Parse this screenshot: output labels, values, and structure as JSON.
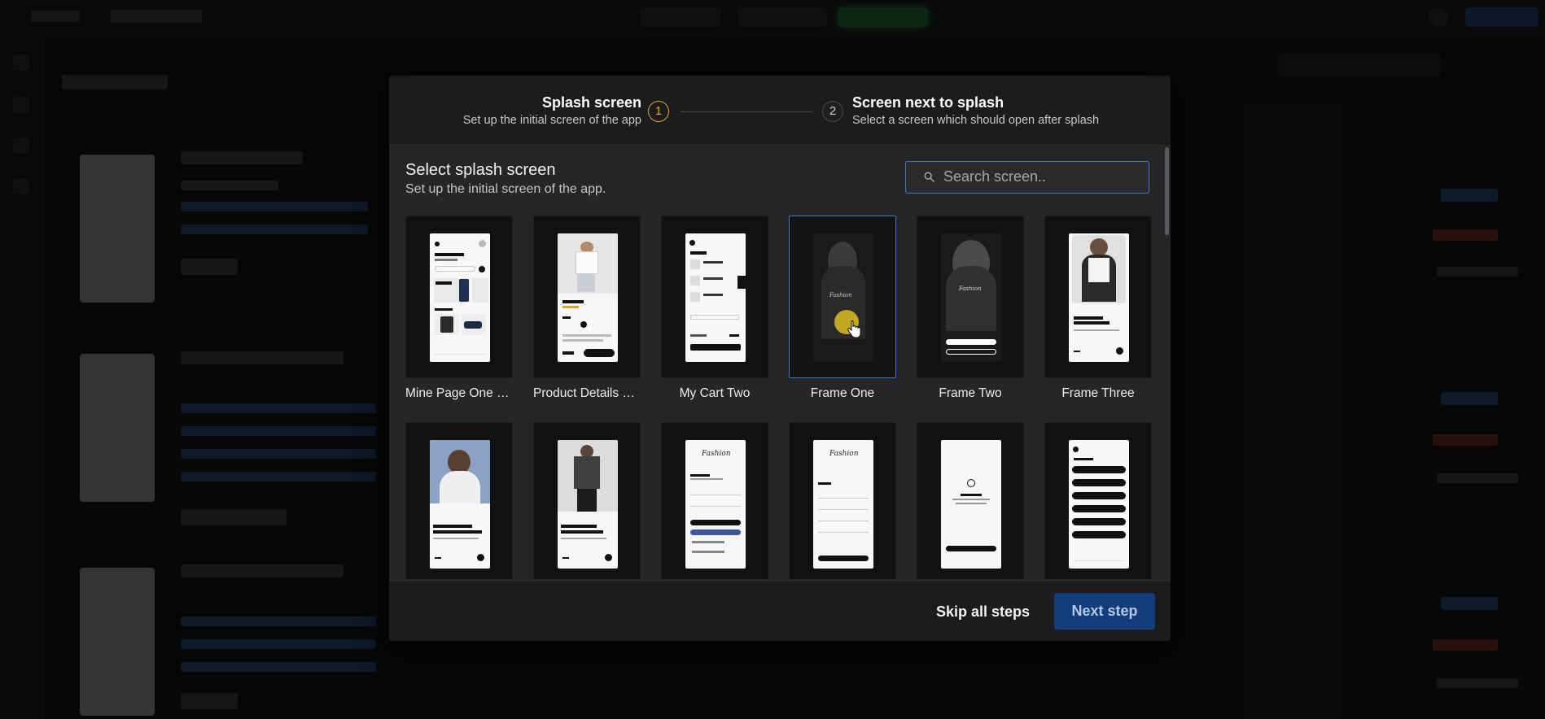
{
  "stepper": {
    "steps": [
      {
        "number": "1",
        "title": "Splash screen",
        "subtitle": "Set up the initial screen of the app",
        "state": "active"
      },
      {
        "number": "2",
        "title": "Screen next to splash",
        "subtitle": "Select a screen which should open after splash",
        "state": "pending"
      }
    ]
  },
  "section": {
    "title": "Select splash screen",
    "subtitle": "Set up the initial screen of the app."
  },
  "search": {
    "placeholder": "Search screen..",
    "value": ""
  },
  "screens": [
    {
      "label": "Mine Page One - Consistent",
      "selected": false
    },
    {
      "label": "Product Details One",
      "selected": false
    },
    {
      "label": "My Cart Two",
      "selected": false
    },
    {
      "label": "Frame One",
      "selected": true
    },
    {
      "label": "Frame Two",
      "selected": false
    },
    {
      "label": "Frame Three",
      "selected": false
    },
    {
      "label": "",
      "selected": false
    },
    {
      "label": "",
      "selected": false
    },
    {
      "label": "",
      "selected": false
    },
    {
      "label": "",
      "selected": false
    },
    {
      "label": "",
      "selected": false
    },
    {
      "label": "",
      "selected": false
    }
  ],
  "footer": {
    "skip_label": "Skip all steps",
    "next_label": "Next step"
  },
  "colors": {
    "accent": "#3a78d8",
    "active_step": "#e3a322",
    "primary_button": "#143d7e"
  }
}
